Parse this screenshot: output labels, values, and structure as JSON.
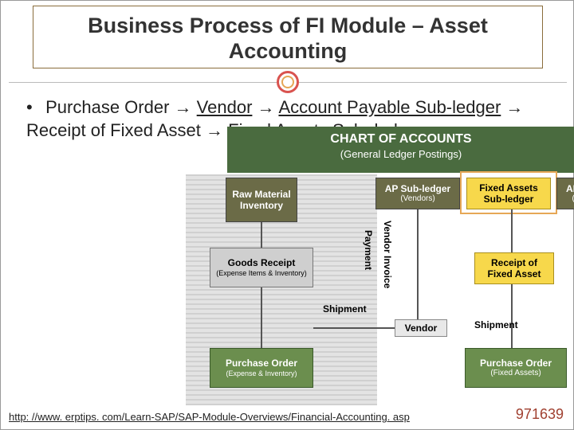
{
  "title": "Business Process of FI Module – Asset Accounting",
  "flow": [
    "Purchase Order",
    "Vendor",
    "Account Payable Sub-ledger",
    "Receipt of Fixed Asset",
    "Fixed Assets Sub -ledger"
  ],
  "diagram": {
    "header": {
      "line1": "CHART OF ACCOUNTS",
      "line2": "(General Ledger Postings)"
    },
    "boxes": {
      "raw": "Raw Material Inventory",
      "goods_receipt": {
        "t1": "Goods Receipt",
        "t2": "(Expense Items & Inventory)"
      },
      "po_expense": {
        "t1": "Purchase Order",
        "t2": "(Expense & Inventory)"
      },
      "ap": {
        "t1": "AP Sub-ledger",
        "t2": "(Vendors)"
      },
      "fa": "Fixed Assets Sub-ledger",
      "ar": {
        "t1": "AR Su",
        "t2": "(Cus"
      },
      "receipt_fa": "Receipt of Fixed Asset",
      "vendor": "Vendor",
      "po_fa": {
        "t1": "Purchase Order",
        "t2": "(Fixed Assets)"
      }
    },
    "labels": {
      "shipment": "Shipment",
      "payment": "Payment",
      "vendor_invoice": "Vendor Invoice"
    }
  },
  "footer": {
    "link": "http: //www. erptips. com/Learn-SAP/SAP-Module-Overviews/Financial-Accounting. asp",
    "number": "971639"
  }
}
